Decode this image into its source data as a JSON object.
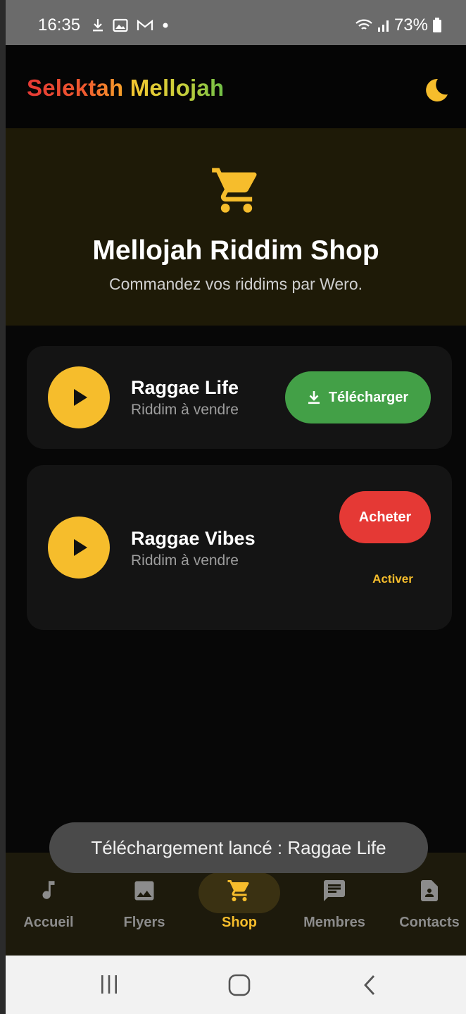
{
  "status_bar": {
    "time": "16:35",
    "battery": "73%"
  },
  "header": {
    "brand_part1": "Selektah",
    "brand_part2": "Mellojah"
  },
  "hero": {
    "title": "Mellojah Riddim Shop",
    "subtitle": "Commandez vos riddims par Wero."
  },
  "riddims": [
    {
      "title": "Raggae Life",
      "subtitle": "Riddim à vendre",
      "action_label": "Télécharger"
    },
    {
      "title": "Raggae Vibes",
      "subtitle": "Riddim à vendre",
      "action_label": "Acheter",
      "secondary_label": "Activer"
    }
  ],
  "bottom_nav": {
    "items": [
      {
        "label": "Accueil",
        "icon": "music-note-icon",
        "active": false
      },
      {
        "label": "Flyers",
        "icon": "image-icon",
        "active": false
      },
      {
        "label": "Shop",
        "icon": "cart-icon",
        "active": true
      },
      {
        "label": "Membres",
        "icon": "chat-icon",
        "active": false
      },
      {
        "label": "Contacts",
        "icon": "contact-card-icon",
        "active": false
      }
    ]
  },
  "toast": {
    "message": "Téléchargement lancé : Raggae Life"
  },
  "colors": {
    "accent_yellow": "#f6bd2c",
    "download_green": "#43a047",
    "buy_red": "#e53935",
    "hero_bg": "#1e1a07",
    "nav_bg": "#1d1a0c"
  }
}
